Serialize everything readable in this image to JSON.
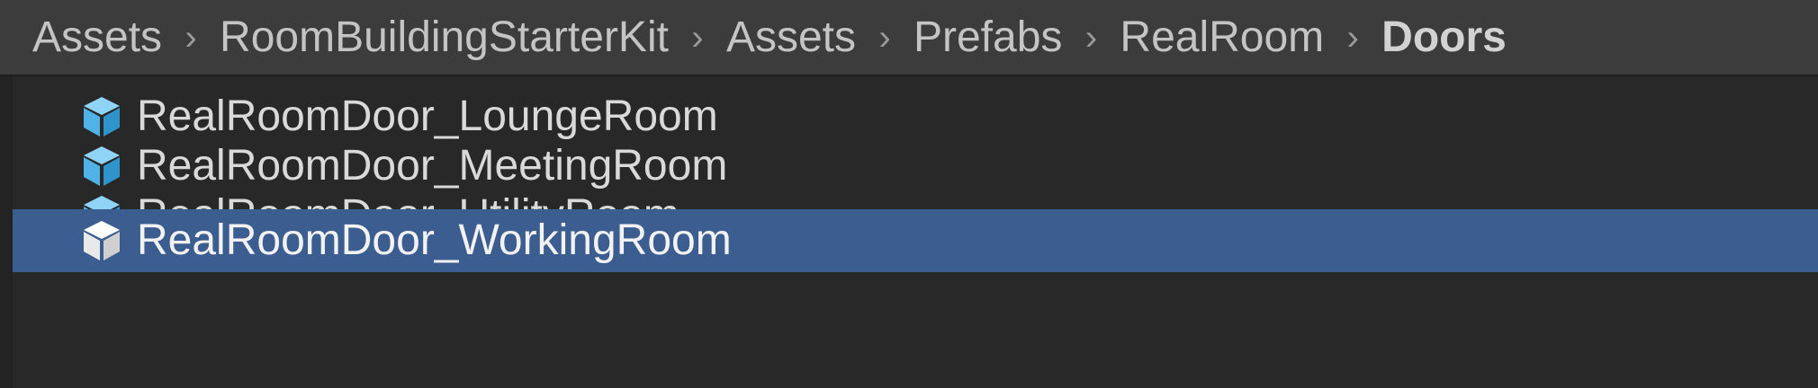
{
  "breadcrumb": {
    "items": [
      "Assets",
      "RoomBuildingStarterKit",
      "Assets",
      "Prefabs",
      "RealRoom",
      "Doors"
    ],
    "separator": "›"
  },
  "list": {
    "items": [
      {
        "label": "RealRoomDoor_LoungeRoom",
        "icon": "prefab-cube-icon",
        "selected": false
      },
      {
        "label": "RealRoomDoor_MeetingRoom",
        "icon": "prefab-cube-icon",
        "selected": false
      },
      {
        "label": "RealRoomDoor_UtilityRoom",
        "icon": "prefab-cube-icon",
        "selected": false
      },
      {
        "label": "RealRoomDoor_WorkingRoom",
        "icon": "prefab-cube-icon",
        "selected": true
      }
    ]
  },
  "colors": {
    "background": "#282828",
    "breadcrumb_bar": "#3c3c3c",
    "selection": "#3c5d8f",
    "prefab_icon": "#4fb3e8",
    "prefab_icon_selected": "#ffffff"
  }
}
